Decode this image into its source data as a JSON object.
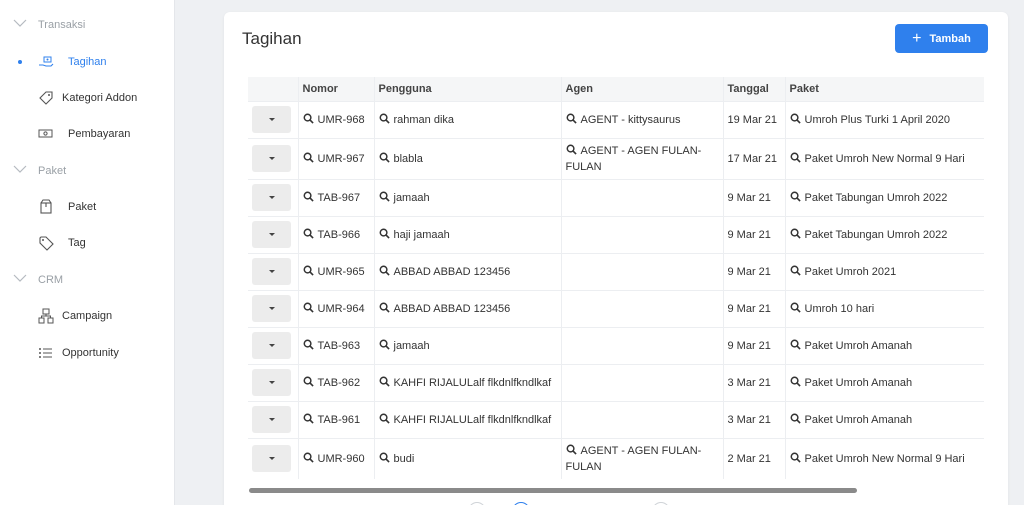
{
  "sidebar": {
    "sections": [
      {
        "label": "Transaksi",
        "items": [
          {
            "label": "Tagihan",
            "icon": "hand-money-icon",
            "active": true
          },
          {
            "label": "Kategori Addon",
            "icon": "tag-icon",
            "active": false
          },
          {
            "label": "Pembayaran",
            "icon": "cash-icon",
            "active": false
          }
        ]
      },
      {
        "label": "Paket",
        "items": [
          {
            "label": "Paket",
            "icon": "package-icon",
            "active": false
          },
          {
            "label": "Tag",
            "icon": "tag-icon",
            "active": false
          }
        ]
      },
      {
        "label": "CRM",
        "items": [
          {
            "label": "Campaign",
            "icon": "sitemap-icon",
            "active": false
          },
          {
            "label": "Opportunity",
            "icon": "list-icon",
            "active": false
          }
        ]
      }
    ]
  },
  "page": {
    "title": "Tagihan",
    "add_label": "Tambah"
  },
  "table": {
    "headers": [
      "",
      "Nomor",
      "Pengguna",
      "Agen",
      "Tanggal",
      "Paket"
    ],
    "rows": [
      {
        "nomor": "UMR-968",
        "pengguna": "rahman dika",
        "agen": "AGENT - kittysaurus",
        "tanggal": "19 Mar 21",
        "paket": "Umroh Plus Turki 1 April 2020"
      },
      {
        "nomor": "UMR-967",
        "pengguna": "blabla",
        "agen": "AGENT - AGEN FULAN-FULAN",
        "tanggal": "17 Mar 21",
        "paket": "Paket Umroh New Normal 9 Hari"
      },
      {
        "nomor": "TAB-967",
        "pengguna": "jamaah",
        "agen": "",
        "tanggal": "9 Mar 21",
        "paket": "Paket Tabungan Umroh 2022"
      },
      {
        "nomor": "TAB-966",
        "pengguna": "haji jamaah",
        "agen": "",
        "tanggal": "9 Mar 21",
        "paket": "Paket Tabungan Umroh 2022"
      },
      {
        "nomor": "UMR-965",
        "pengguna": "ABBAD ABBAD 123456",
        "agen": "",
        "tanggal": "9 Mar 21",
        "paket": "Paket Umroh 2021"
      },
      {
        "nomor": "UMR-964",
        "pengguna": "ABBAD ABBAD 123456",
        "agen": "",
        "tanggal": "9 Mar 21",
        "paket": "Umroh 10 hari"
      },
      {
        "nomor": "TAB-963",
        "pengguna": "jamaah",
        "agen": "",
        "tanggal": "9 Mar 21",
        "paket": "Paket Umroh Amanah"
      },
      {
        "nomor": "TAB-962",
        "pengguna": "KAHFI RIJALULalf flkdnlfkndlkaf",
        "agen": "",
        "tanggal": "3 Mar 21",
        "paket": "Paket Umroh Amanah"
      },
      {
        "nomor": "TAB-961",
        "pengguna": "KAHFI RIJALULalf flkdnlfkndlkaf",
        "agen": "",
        "tanggal": "3 Mar 21",
        "paket": "Paket Umroh Amanah"
      },
      {
        "nomor": "UMR-960",
        "pengguna": "budi",
        "agen": "AGENT - AGEN FULAN-FULAN",
        "tanggal": "2 Mar 21",
        "paket": "Paket Umroh New Normal 9 Hari"
      }
    ]
  },
  "colors": {
    "accent": "#2f80ed",
    "muted": "#9aa0a6"
  }
}
